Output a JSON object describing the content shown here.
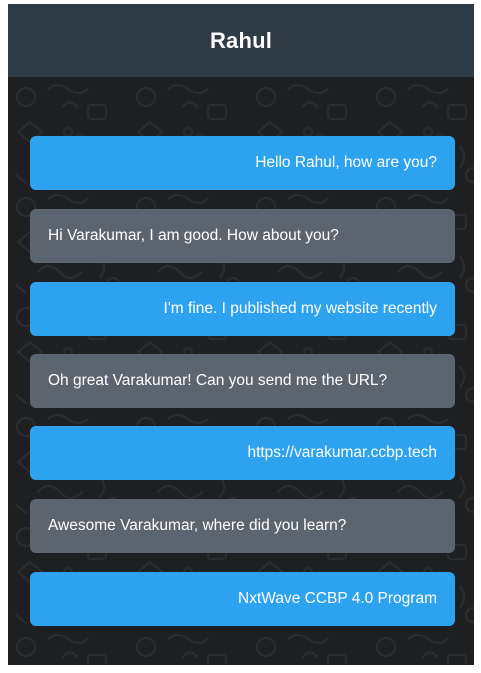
{
  "header": {
    "title": "Rahul"
  },
  "colors": {
    "header_bg": "#2e3a44",
    "chat_bg": "#1e1f21",
    "sent_bubble": "#2da3f0",
    "received_bubble": "#5b6570"
  },
  "messages": [
    {
      "type": "sent",
      "text": "Hello Rahul, how are you?"
    },
    {
      "type": "received",
      "text": "Hi Varakumar, I am good. How about you?"
    },
    {
      "type": "sent",
      "text": "I'm fine. I published my website recently"
    },
    {
      "type": "received",
      "text": "Oh great Varakumar! Can you send me the URL?"
    },
    {
      "type": "sent",
      "text": "https://varakumar.ccbp.tech"
    },
    {
      "type": "received",
      "text": "Awesome Varakumar, where did you learn?"
    },
    {
      "type": "sent",
      "text": "NxtWave CCBP 4.0 Program"
    }
  ]
}
